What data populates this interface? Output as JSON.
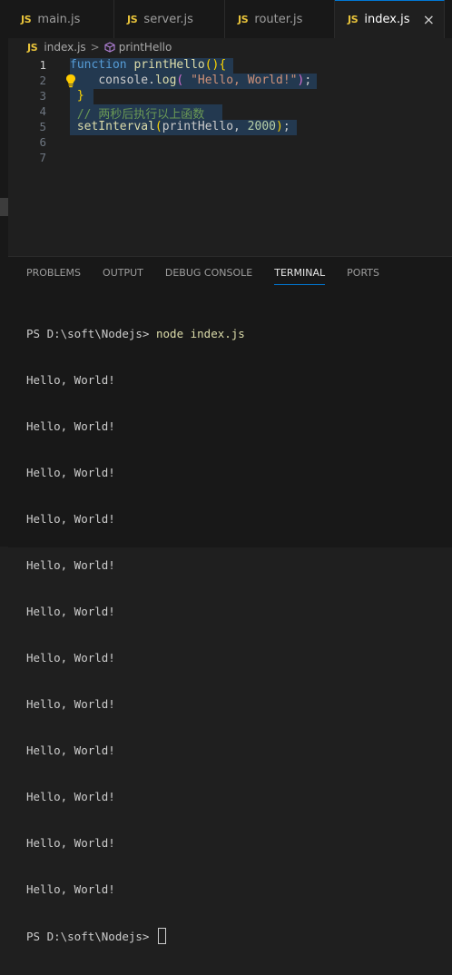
{
  "tabs": [
    {
      "icon": "JS",
      "label": "main.js"
    },
    {
      "icon": "JS",
      "label": "server.js"
    },
    {
      "icon": "JS",
      "label": "router.js"
    },
    {
      "icon": "JS",
      "label": "index.js",
      "active": true
    }
  ],
  "close_symbol": "×",
  "breadcrumb": {
    "icon": "JS",
    "file": "index.js",
    "separator": ">",
    "symbol": "printHello"
  },
  "editor": {
    "line_numbers": [
      "1",
      "2",
      "3",
      "4",
      "5",
      "6",
      "7"
    ],
    "current_line": 1,
    "lines": [
      [
        {
          "t": "kw",
          "v": "function"
        },
        {
          "t": "",
          "v": " "
        },
        {
          "t": "fn",
          "v": "printHello"
        },
        {
          "t": "br1",
          "v": "(){"
        }
      ],
      [
        {
          "t": "",
          "v": "    "
        },
        {
          "t": "",
          "v": "console."
        },
        {
          "t": "fn",
          "v": "log"
        },
        {
          "t": "br2",
          "v": "("
        },
        {
          "t": "",
          "v": " "
        },
        {
          "t": "str",
          "v": "\"Hello, World!\""
        },
        {
          "t": "br2",
          "v": ")"
        },
        {
          "t": "",
          "v": ";"
        }
      ],
      [
        {
          "t": "",
          "v": " "
        },
        {
          "t": "br1",
          "v": "}"
        }
      ],
      [
        {
          "t": "",
          "v": " "
        },
        {
          "t": "cm",
          "v": "// 两秒后执行以上函数"
        }
      ],
      [
        {
          "t": "",
          "v": " "
        },
        {
          "t": "fn",
          "v": "setInterval"
        },
        {
          "t": "br1",
          "v": "("
        },
        {
          "t": "",
          "v": "printHello, "
        },
        {
          "t": "num",
          "v": "2000"
        },
        {
          "t": "br1",
          "v": ")"
        },
        {
          "t": "",
          "v": ";"
        }
      ],
      [],
      []
    ]
  },
  "panel": {
    "tabs": [
      "PROBLEMS",
      "OUTPUT",
      "DEBUG CONSOLE",
      "TERMINAL",
      "PORTS"
    ],
    "active_tab": "TERMINAL"
  },
  "terminal": {
    "prompt": "PS D:\\soft\\Nodejs> ",
    "command": "node index.js",
    "output": [
      "Hello, World!",
      "Hello, World!",
      "Hello, World!",
      "Hello, World!",
      "Hello, World!",
      "Hello, World!",
      "Hello, World!",
      "Hello, World!",
      "Hello, World!",
      "Hello, World!",
      "Hello, World!",
      "Hello, World!"
    ],
    "final_prompt": "PS D:\\soft\\Nodejs> "
  },
  "colors": {
    "accent": "#0078d4",
    "js_icon": "#e8c33a",
    "keyword": "#569cd6",
    "function": "#dcdcaa",
    "string": "#ce9178",
    "number": "#b5cea8",
    "comment": "#6a9955"
  }
}
